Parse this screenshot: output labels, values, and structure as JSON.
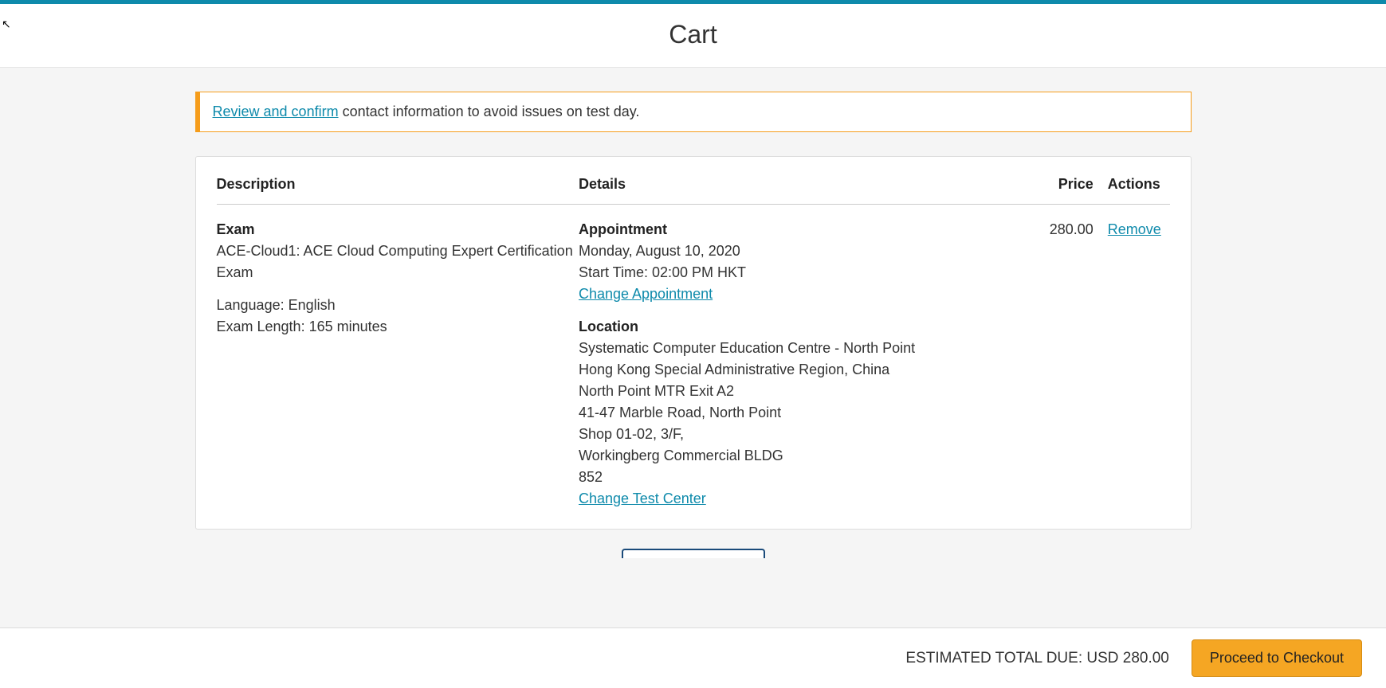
{
  "header": {
    "title": "Cart"
  },
  "alert": {
    "link_text": "Review and confirm",
    "rest_text": " contact information to avoid issues on test day."
  },
  "columns": {
    "description": "Description",
    "details": "Details",
    "price": "Price",
    "actions": "Actions"
  },
  "item": {
    "description": {
      "heading": "Exam",
      "name": "ACE-Cloud1: ACE Cloud Computing Expert Certification Exam",
      "language": "Language: English",
      "length": "Exam Length: 165 minutes"
    },
    "details": {
      "appointment_heading": "Appointment",
      "date": "Monday, August 10, 2020",
      "start_time": "Start Time: 02:00 PM HKT",
      "change_appointment": "Change Appointment",
      "location_heading": "Location",
      "loc_line1": "Systematic Computer Education Centre - North Point",
      "loc_line2": "Hong Kong Special Administrative Region, China",
      "loc_line3": "North Point MTR Exit A2",
      "loc_line4": "41-47 Marble Road, North Point",
      "loc_line5": "Shop 01-02, 3/F,",
      "loc_line6": "Workingberg Commercial BLDG",
      "loc_line7": "852",
      "change_test_center": "Change Test Center"
    },
    "price": "280.00",
    "remove": "Remove"
  },
  "footer": {
    "total": "ESTIMATED TOTAL DUE: USD 280.00",
    "checkout": "Proceed to Checkout"
  }
}
